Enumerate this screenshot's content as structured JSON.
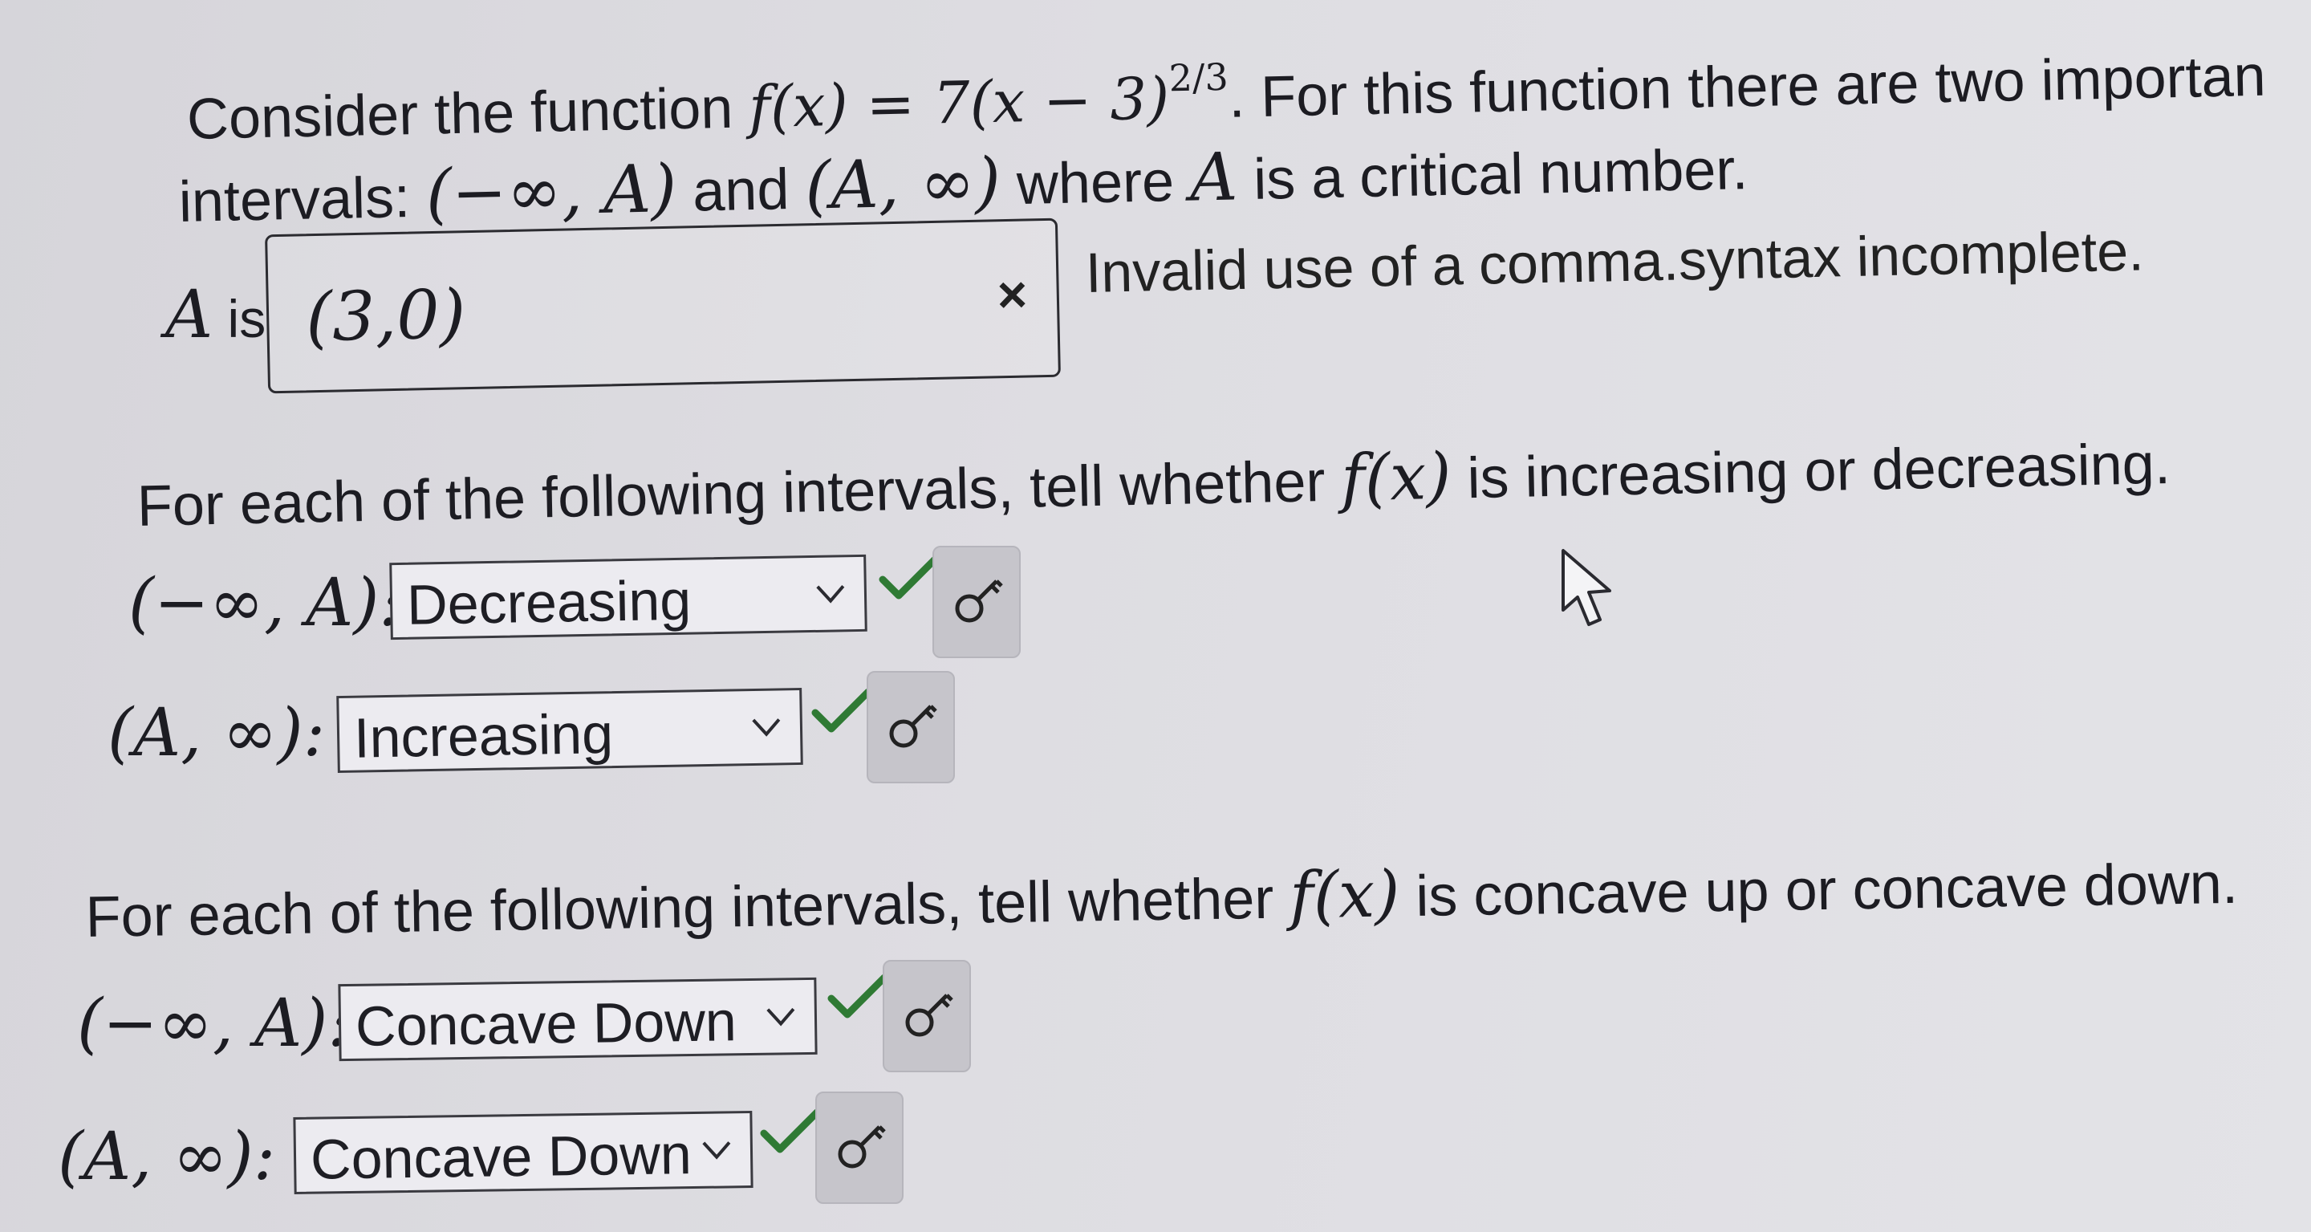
{
  "problem": {
    "intro_1": "Consider the function ",
    "func_lhs": "f(x) = 7(x − 3)",
    "exponent": "2/3",
    "intro_2": ". For this function there are two importan",
    "line2_prefix": "intervals: ",
    "interval_left": "(−∞, A)",
    "and_word": " and ",
    "interval_right": "(A, ∞)",
    "line2_suffix": " where ",
    "var_a": "A",
    "line2_end": " is a critical number."
  },
  "critical": {
    "label_var": "A",
    "label_is": " is",
    "input_value": "(3,0)",
    "error_mark": "×",
    "error_message": "Invalid use of a comma.syntax incomplete."
  },
  "increasing_section": {
    "prompt_prefix": "For each of the following intervals, tell whether ",
    "prompt_func": "f(x)",
    "prompt_suffix": " is increasing or decreasing.",
    "rows": [
      {
        "interval": "(−∞, A):",
        "selected": "Decreasing"
      },
      {
        "interval": "(A, ∞):",
        "selected": "Increasing"
      }
    ]
  },
  "concavity_section": {
    "prompt_prefix": "For each of the following intervals, tell whether ",
    "prompt_func": "f(x)",
    "prompt_suffix": " is concave up or concave down.",
    "rows": [
      {
        "interval": "(−∞, A):",
        "selected": "Concave Down"
      },
      {
        "interval": "(A, ∞):",
        "selected": "Concave Down"
      }
    ]
  },
  "icons": {
    "dropdown": "chevron-down-icon",
    "correct": "checkmark-icon",
    "key": "key-icon",
    "cursor": "mouse-pointer-icon"
  },
  "colors": {
    "correct_check": "#2f7a34",
    "text": "#1c1c22",
    "background": "#dedde2"
  }
}
